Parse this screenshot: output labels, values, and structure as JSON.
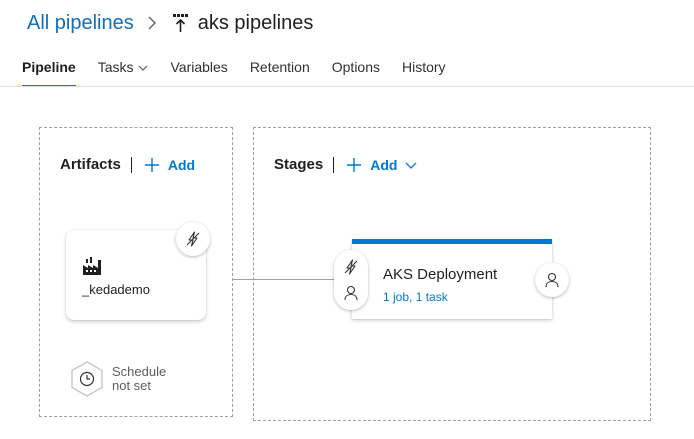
{
  "breadcrumb": {
    "root": "All pipelines",
    "title": "aks pipelines"
  },
  "tabs": [
    {
      "label": "Pipeline",
      "active": true
    },
    {
      "label": "Tasks",
      "dropdown": true
    },
    {
      "label": "Variables"
    },
    {
      "label": "Retention"
    },
    {
      "label": "Options"
    },
    {
      "label": "History"
    }
  ],
  "artifacts": {
    "title": "Artifacts",
    "add_label": "Add",
    "items": [
      {
        "name": "_kedademo",
        "icon": "build-icon"
      }
    ],
    "schedule": {
      "line1": "Schedule",
      "line2": "not set"
    }
  },
  "stages": {
    "title": "Stages",
    "add_label": "Add",
    "items": [
      {
        "name": "AKS Deployment",
        "summary": "1 job, 1 task"
      }
    ]
  },
  "colors": {
    "accent": "#0078d4",
    "link": "#106ebe",
    "text": "#201f1e",
    "muted": "#605e5c",
    "dashed_border": "#a19f9d"
  }
}
